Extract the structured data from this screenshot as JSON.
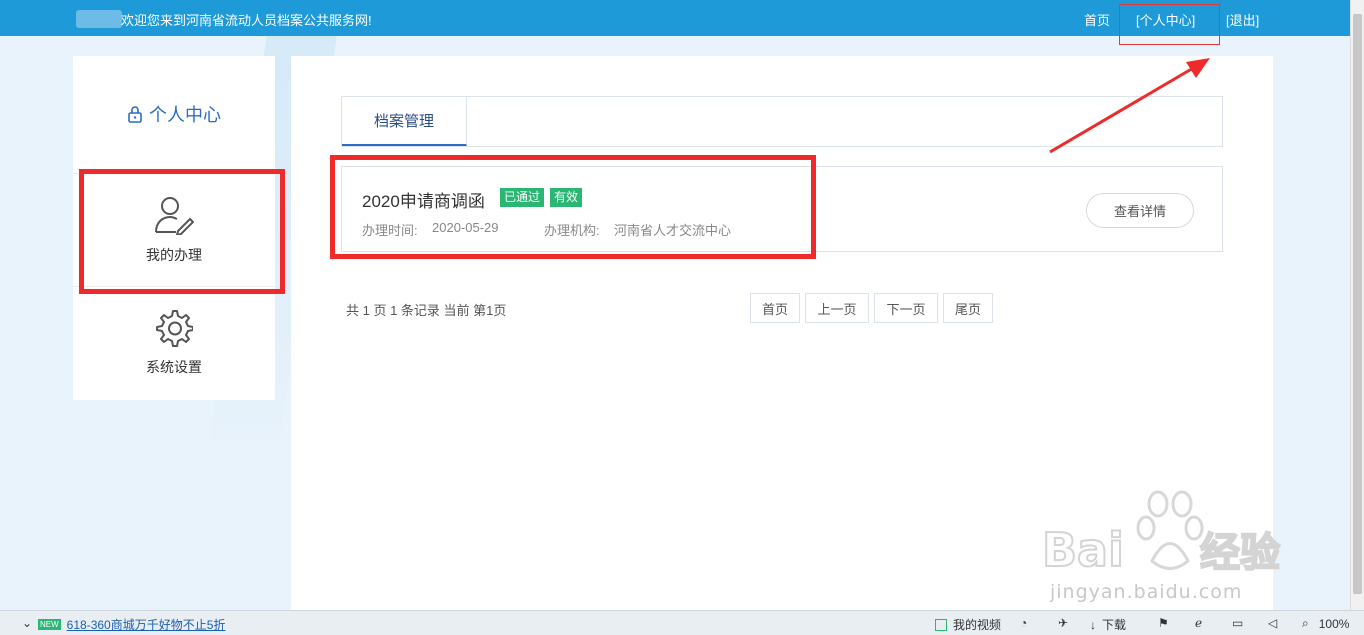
{
  "header": {
    "welcome": "欢迎您来到河南省流动人员档案公共服务网!",
    "links": {
      "home": "首页",
      "personal_center": "[个人中心]",
      "logout": "[退出]"
    }
  },
  "sidebar": {
    "title": "个人中心",
    "items": [
      {
        "label": "我的办理",
        "icon": "user-edit-icon"
      },
      {
        "label": "系统设置",
        "icon": "gear-icon"
      }
    ]
  },
  "main": {
    "tab": "档案管理",
    "record": {
      "title": "2020申请商调函",
      "badges": [
        "已通过",
        "有效"
      ],
      "time_label": "办理时间:",
      "time_value": "2020-05-29",
      "org_label": "办理机构:",
      "org_value": "河南省人才交流中心",
      "detail_button": "查看详情"
    },
    "pagination": {
      "info": "共 1 页 1 条记录 当前 第1页",
      "buttons": [
        "首页",
        "上一页",
        "下一页",
        "尾页"
      ]
    }
  },
  "statusbar": {
    "new_tag": "NEW",
    "promo": "618-360商城万千好物不止5折",
    "video": "我的视频",
    "download": "下载",
    "zoom": "100%"
  },
  "colors": {
    "topbar": "#1e9ad9",
    "accent": "#2b6cc4",
    "badge": "#2bb673",
    "annotation": "#ee2a2a"
  }
}
